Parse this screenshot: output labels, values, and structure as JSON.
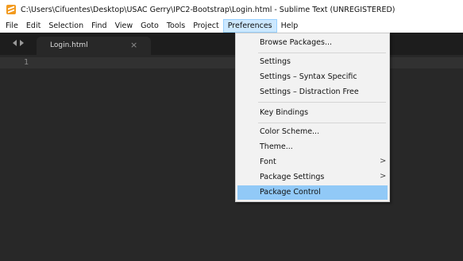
{
  "window": {
    "title": "C:\\Users\\Cifuentes\\Desktop\\USAC Gerry\\IPC2-Bootstrap\\Login.html - Sublime Text (UNREGISTERED)"
  },
  "menubar": {
    "items": [
      "File",
      "Edit",
      "Selection",
      "Find",
      "View",
      "Goto",
      "Tools",
      "Project",
      "Preferences",
      "Help"
    ],
    "active": "Preferences"
  },
  "tabs": [
    {
      "label": "Login.html",
      "close": "×"
    }
  ],
  "editor": {
    "line_numbers": [
      "1"
    ]
  },
  "preferences_menu": {
    "browse_packages": "Browse Packages...",
    "settings": "Settings",
    "settings_syntax": "Settings – Syntax Specific",
    "settings_distraction": "Settings – Distraction Free",
    "key_bindings": "Key Bindings",
    "color_scheme": "Color Scheme...",
    "theme": "Theme...",
    "font": "Font",
    "package_settings": "Package Settings",
    "package_control": "Package Control",
    "submenu_arrow": ">"
  },
  "colors": {
    "editor_bg": "#282828",
    "tabbar_bg": "#1d1d1d",
    "menu_highlight": "#91c9f7",
    "brand_orange": "#f29a1e"
  }
}
